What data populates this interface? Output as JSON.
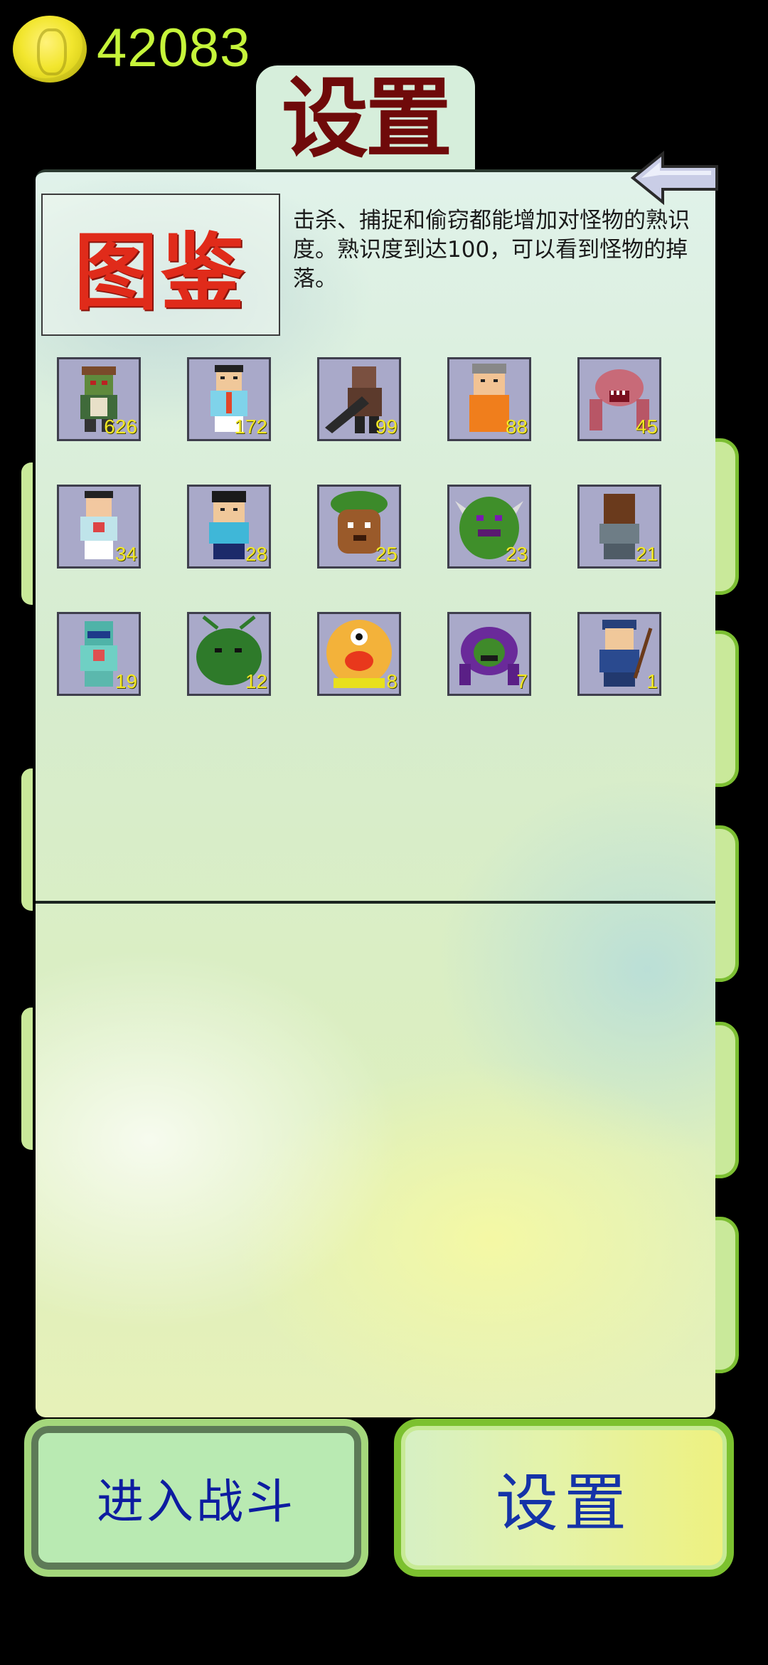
{
  "currency": {
    "icon": "coin-icon",
    "amount": "42083"
  },
  "title_tab": {
    "label": "设置"
  },
  "codex": {
    "heading": "图鉴",
    "description": "击杀、捕捉和偷窃都能增加对怪物的熟识度。熟识度到达100，可以看到怪物的掉落。"
  },
  "monsters": [
    {
      "name": "zombie-monster-icon",
      "count": "626"
    },
    {
      "name": "office-worker-monster-icon",
      "count": "172"
    },
    {
      "name": "chainsaw-monster-icon",
      "count": "99"
    },
    {
      "name": "prisoner-monster-icon",
      "count": "88"
    },
    {
      "name": "pink-crawler-monster-icon",
      "count": "45"
    },
    {
      "name": "patient-monster-icon",
      "count": "34"
    },
    {
      "name": "student-monster-icon",
      "count": "28"
    },
    {
      "name": "tree-stump-monster-icon",
      "count": "25"
    },
    {
      "name": "green-horned-monster-icon",
      "count": "23"
    },
    {
      "name": "dark-skin-man-monster-icon",
      "count": "21"
    },
    {
      "name": "surgeon-monster-icon",
      "count": "19"
    },
    {
      "name": "green-bug-monster-icon",
      "count": "12"
    },
    {
      "name": "cyclops-monster-icon",
      "count": "8"
    },
    {
      "name": "purple-beast-monster-icon",
      "count": "7"
    },
    {
      "name": "soldier-monster-icon",
      "count": "1"
    }
  ],
  "buttons": {
    "battle": "进入战斗",
    "settings": "设置"
  },
  "colors": {
    "currency_text": "#c6f53a",
    "title_text": "#6f0a0a",
    "codex_heading": "#e02b1a",
    "button_text": "#0d1ca0",
    "count_text": "#f3e826"
  }
}
